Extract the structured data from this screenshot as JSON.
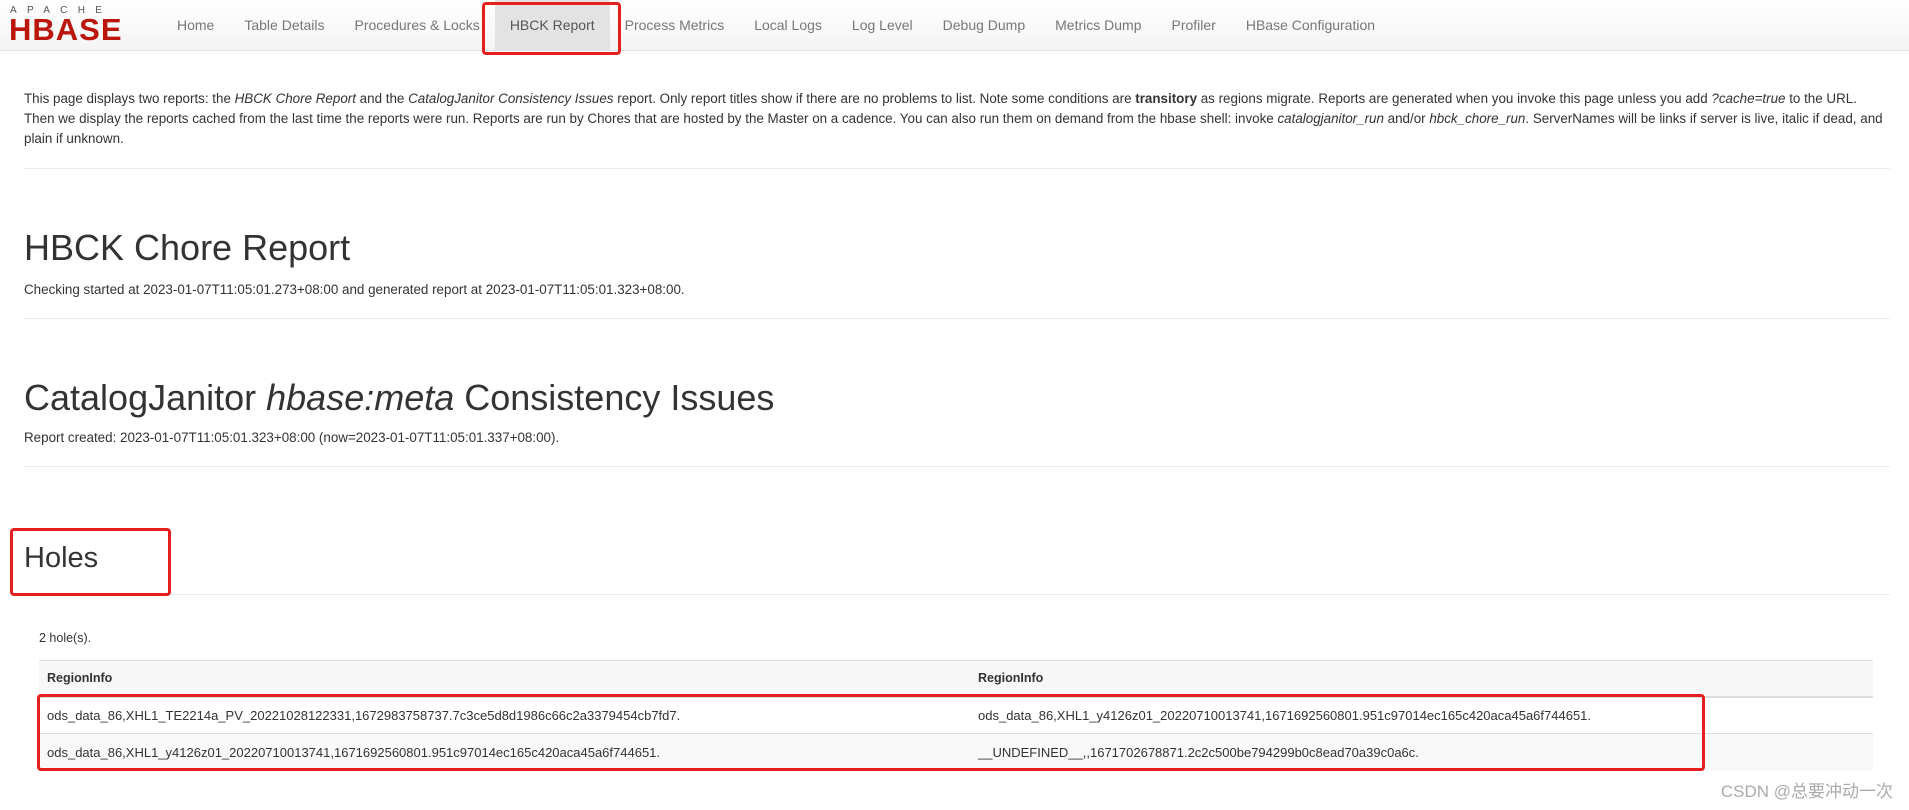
{
  "brand": {
    "top": "APACHE",
    "main": "HBASE"
  },
  "nav": {
    "items": [
      {
        "label": "Home"
      },
      {
        "label": "Table Details"
      },
      {
        "label": "Procedures & Locks"
      },
      {
        "label": "HBCK Report"
      },
      {
        "label": "Process Metrics"
      },
      {
        "label": "Local Logs"
      },
      {
        "label": "Log Level"
      },
      {
        "label": "Debug Dump"
      },
      {
        "label": "Metrics Dump"
      },
      {
        "label": "Profiler"
      },
      {
        "label": "HBase Configuration"
      }
    ],
    "active_index": 3
  },
  "intro": {
    "t1": "This page displays two reports: the ",
    "e1": "HBCK Chore Report",
    "t2": " and the ",
    "e2": "CatalogJanitor Consistency Issues",
    "t3": " report. Only report titles show if there are no problems to list. Note some conditions are ",
    "b1": "transitory",
    "t4": " as regions migrate. Reports are generated when you invoke this page unless you add ",
    "e3": "?cache=true",
    "t5": " to the URL. Then we display the reports cached from the last time the reports were run. Reports are run by Chores that are hosted by the Master on a cadence. You can also run them on demand from the hbase shell: invoke ",
    "e4": "catalogjanitor_run",
    "t6": " and/or ",
    "e5": "hbck_chore_run",
    "t7": ". ServerNames will be links if server is live, italic if dead, and plain if unknown."
  },
  "hbck": {
    "title": "HBCK Chore Report",
    "subtitle": "Checking started at 2023-01-07T11:05:01.273+08:00 and generated report at 2023-01-07T11:05:01.323+08:00."
  },
  "janitor": {
    "title_pre": "CatalogJanitor ",
    "title_em": "hbase:meta",
    "title_post": " Consistency Issues",
    "subtitle": "Report created: 2023-01-07T11:05:01.323+08:00 (now=2023-01-07T11:05:01.337+08:00)."
  },
  "holes": {
    "title": "Holes",
    "count": "2 hole(s).",
    "headers": [
      "RegionInfo",
      "RegionInfo"
    ],
    "rows": [
      [
        "ods_data_86,XHL1_TE2214a_PV_20221028122331,1672983758737.7c3ce5d8d1986c66c2a3379454cb7fd7.",
        "ods_data_86,XHL1_y4126z01_20220710013741,1671692560801.951c97014ec165c420aca45a6f744651."
      ],
      [
        "ods_data_86,XHL1_y4126z01_20220710013741,1671692560801.951c97014ec165c420aca45a6f744651.",
        "__UNDEFINED__,,1671702678871.2c2c500be794299b0c8ead70a39c0a6c."
      ]
    ]
  },
  "watermark": "CSDN @总要冲动一次",
  "colors": {
    "brand_red": "#ba160c",
    "annotation_red": "#e41f1f",
    "nav_active_bg": "#e3e3e3"
  }
}
